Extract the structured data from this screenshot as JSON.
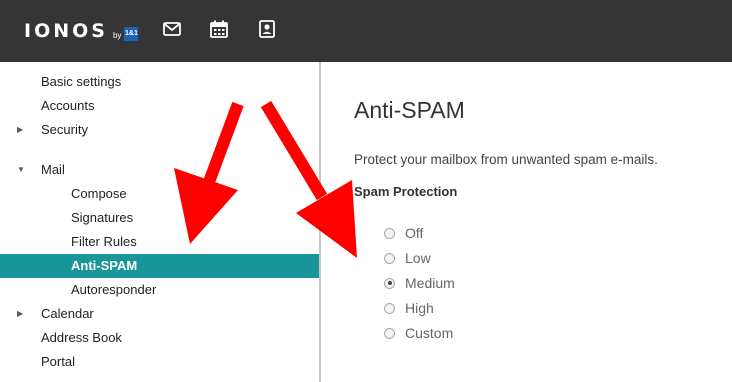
{
  "header": {
    "logo_text": "IONOS",
    "logo_by": "by",
    "logo_badge": "1&1",
    "icons": [
      "mail-icon",
      "calendar-icon",
      "address-book-icon"
    ]
  },
  "sidebar": {
    "items": [
      {
        "label": "Basic settings"
      },
      {
        "label": "Accounts"
      },
      {
        "label": "Security",
        "caret": "▶"
      },
      {
        "label": "Mail",
        "caret": "▼"
      },
      {
        "label": "Compose"
      },
      {
        "label": "Signatures"
      },
      {
        "label": "Filter Rules"
      },
      {
        "label": "Anti-SPAM"
      },
      {
        "label": "Autoresponder"
      },
      {
        "label": "Calendar",
        "caret": "▶"
      },
      {
        "label": "Address Book"
      },
      {
        "label": "Portal"
      }
    ]
  },
  "main": {
    "title": "Anti-SPAM",
    "description": "Protect your mailbox from unwanted spam e-mails.",
    "section_label": "Spam Protection",
    "options": [
      "Off",
      "Low",
      "Medium",
      "High",
      "Custom"
    ],
    "selected": "Medium"
  },
  "colors": {
    "topbar": "#353535",
    "active_item": "#18969a",
    "arrow": "#ff0000"
  }
}
